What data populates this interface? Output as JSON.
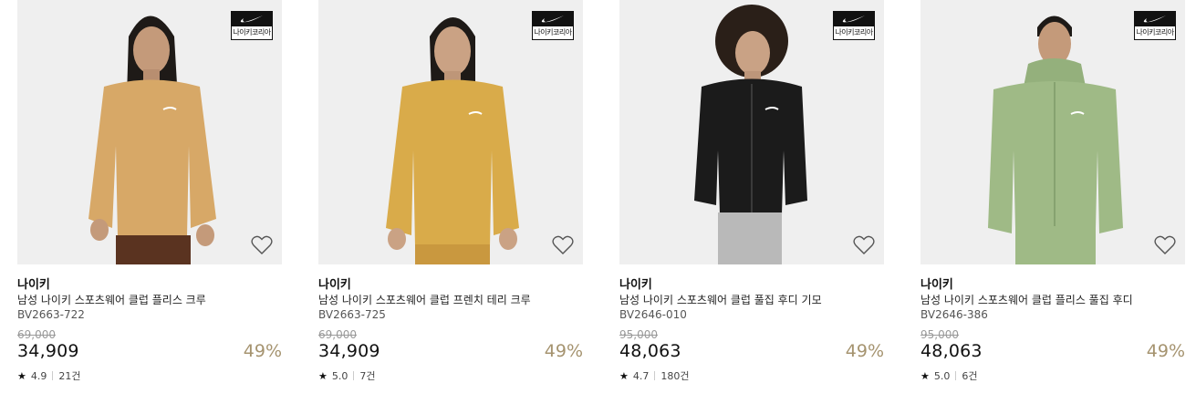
{
  "products": [
    {
      "badge_text": "나이키코리아",
      "brand": "나이키",
      "name": "남성 나이키 스포츠웨어 클럽 플리스 크루",
      "code": "BV2663-722",
      "original_price": "69,000",
      "price": "34,909",
      "discount": "49%",
      "rating": "4.9",
      "reviews": "21건",
      "garment_color": "#d7a867",
      "pants_color": "#5a3320",
      "bg_color": "#ededed"
    },
    {
      "badge_text": "나이키코리아",
      "brand": "나이키",
      "name": "남성 나이키 스포츠웨어 클럽 프렌치 테리 크루",
      "code": "BV2663-725",
      "original_price": "69,000",
      "price": "34,909",
      "discount": "49%",
      "rating": "5.0",
      "reviews": "7건",
      "garment_color": "#d9ab4a",
      "pants_color": "#c9983f",
      "bg_color": "#ededed"
    },
    {
      "badge_text": "나이키코리아",
      "brand": "나이키",
      "name": "남성 나이키 스포츠웨어 클럽 풀집 후디 기모",
      "code": "BV2646-010",
      "original_price": "95,000",
      "price": "48,063",
      "discount": "49%",
      "rating": "4.7",
      "reviews": "180건",
      "garment_color": "#1b1b1b",
      "pants_color": "#b9b9b9",
      "bg_color": "#ededed"
    },
    {
      "badge_text": "나이키코리아",
      "brand": "나이키",
      "name": "남성 나이키 스포츠웨어 클럽 플리스 풀집 후디",
      "code": "BV2646-386",
      "original_price": "95,000",
      "price": "48,063",
      "discount": "49%",
      "rating": "5.0",
      "reviews": "6건",
      "garment_color": "#9fba86",
      "pants_color": "#9fba86",
      "bg_color": "#ededed"
    }
  ]
}
